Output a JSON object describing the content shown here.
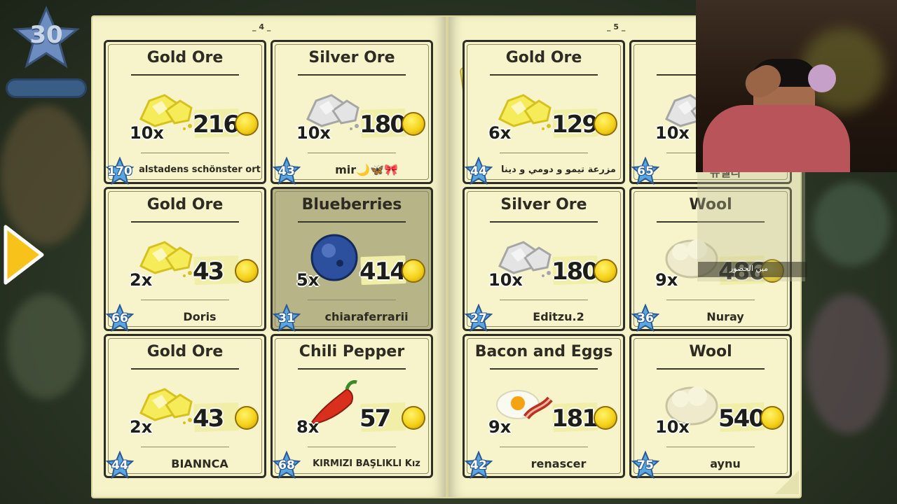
{
  "hud": {
    "level": "30"
  },
  "book": {
    "left_page_number": "4",
    "right_page_number": "5"
  },
  "cards": [
    {
      "title": "Gold Ore",
      "qty": "10x",
      "price": "216",
      "level": "170",
      "seller": "alstadens schönster ort",
      "item_icon": "gold-ore-icon"
    },
    {
      "title": "Silver Ore",
      "qty": "10x",
      "price": "180",
      "level": "43",
      "seller": "mir🌙🦋🎀",
      "item_icon": "silver-ore-icon"
    },
    {
      "title": "Gold Ore",
      "qty": "6x",
      "price": "129",
      "level": "44",
      "seller": "مزرعة تيمو و دومي و دينا",
      "item_icon": "gold-ore-icon"
    },
    {
      "title": "Silv",
      "qty": "10x",
      "price": "",
      "level": "65",
      "seller": "뉴델리",
      "item_icon": "silver-ore-icon"
    },
    {
      "title": "Gold Ore",
      "qty": "2x",
      "price": "43",
      "level": "66",
      "seller": "Doris",
      "item_icon": "gold-ore-icon"
    },
    {
      "title": "Blueberries",
      "qty": "5x",
      "price": "414",
      "level": "31",
      "seller": "chiaraferrarii",
      "item_icon": "blueberry-icon",
      "sold": true
    },
    {
      "title": "Silver Ore",
      "qty": "10x",
      "price": "180",
      "level": "27",
      "seller": "Editzu.2",
      "item_icon": "silver-ore-icon"
    },
    {
      "title": "Wool",
      "qty": "9x",
      "price": "486",
      "level": "36",
      "seller": "Nuray",
      "item_icon": "wool-icon"
    },
    {
      "title": "Gold Ore",
      "qty": "2x",
      "price": "43",
      "level": "44",
      "seller": "BIANNCA",
      "item_icon": "gold-ore-icon"
    },
    {
      "title": "Chili Pepper",
      "qty": "8x",
      "price": "57",
      "level": "68",
      "seller": "KIRMIZI BAŞLIKLI Kız",
      "item_icon": "chili-pepper-icon"
    },
    {
      "title": "Bacon and Eggs",
      "qty": "9x",
      "price": "1814",
      "level": "42",
      "seller": "renascer",
      "item_icon": "bacon-eggs-icon"
    },
    {
      "title": "Wool",
      "qty": "10x",
      "price": "540",
      "level": "75",
      "seller": "aynu",
      "item_icon": "wool-icon"
    }
  ],
  "alert_badge": "!",
  "chat": {
    "message": "مين الحضور"
  },
  "colors": {
    "page": "#f6f3c8",
    "card_border": "#2e2e24",
    "coin": "#f5d21a",
    "level_star": "#5aa6e0"
  }
}
